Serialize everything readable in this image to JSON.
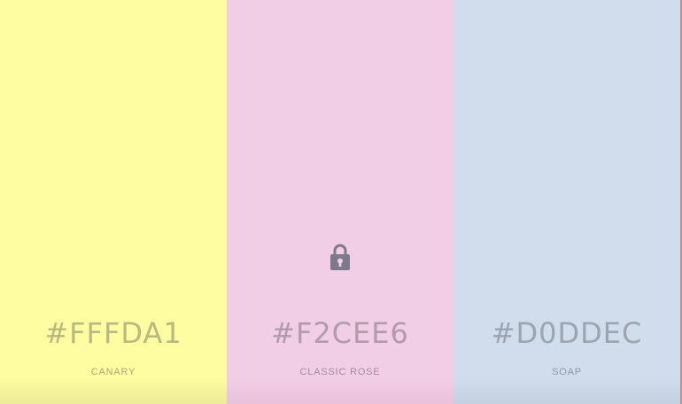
{
  "colors": [
    {
      "hex": "#FFFDA1",
      "name": "CANARY",
      "locked": false
    },
    {
      "hex": "#F2CEE6",
      "name": "CLASSIC ROSE",
      "locked": true
    },
    {
      "hex": "#D0DDEC",
      "name": "SOAP",
      "locked": false
    }
  ],
  "lock_icon": "lock-icon"
}
